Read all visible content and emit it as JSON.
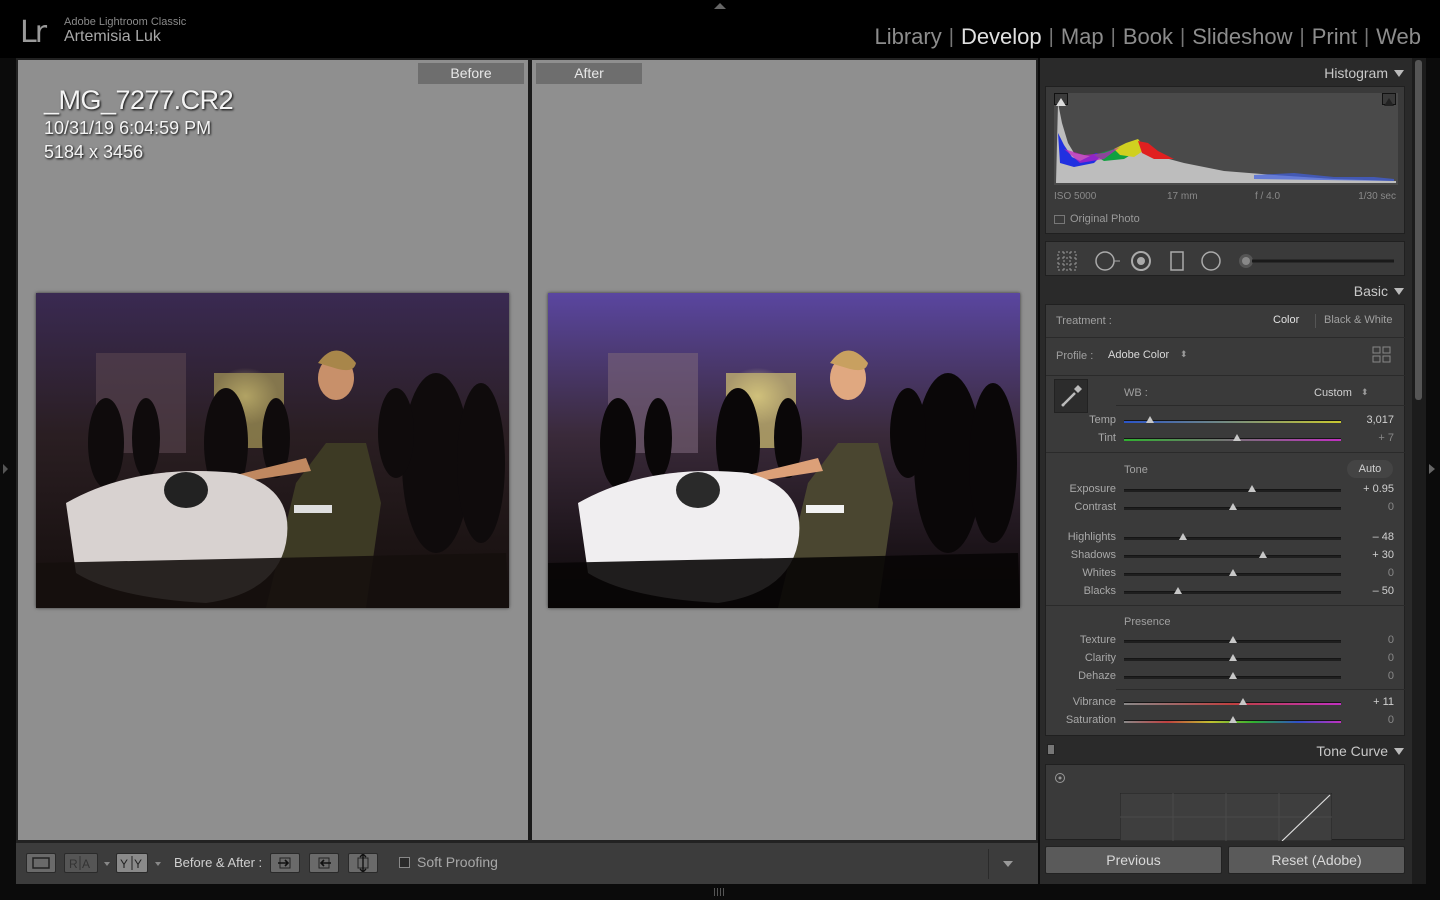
{
  "app": {
    "logo": "Lr",
    "product": "Adobe Lightroom Classic",
    "user": "Artemisia Luk"
  },
  "modules": [
    {
      "label": "Library",
      "active": false
    },
    {
      "label": "Develop",
      "active": true
    },
    {
      "label": "Map",
      "active": false
    },
    {
      "label": "Book",
      "active": false
    },
    {
      "label": "Slideshow",
      "active": false
    },
    {
      "label": "Print",
      "active": false
    },
    {
      "label": "Web",
      "active": false
    }
  ],
  "view": {
    "before_label": "Before",
    "after_label": "After",
    "info": {
      "filename": "_MG_7277.CR2",
      "datetime": "10/31/19 6:04:59 PM",
      "dimensions": "5184 x 3456"
    }
  },
  "toolbar": {
    "before_after_label": "Before & After :",
    "soft_proofing_label": "Soft Proofing",
    "soft_proofing_checked": false
  },
  "histogram": {
    "title": "Histogram",
    "iso": "ISO 5000",
    "focal": "17 mm",
    "aperture": "f / 4.0",
    "shutter": "1/30 sec",
    "original_photo_label": "Original Photo"
  },
  "basic": {
    "title": "Basic",
    "treatment_label": "Treatment :",
    "treatment_color": "Color",
    "treatment_bw": "Black & White",
    "profile_label": "Profile :",
    "profile_value": "Adobe Color",
    "wb_label": "WB :",
    "wb_value": "Custom",
    "tone_label": "Tone",
    "auto_label": "Auto",
    "presence_label": "Presence",
    "sliders": {
      "temp": {
        "label": "Temp",
        "value": "3,017",
        "pos": 0.12
      },
      "tint": {
        "label": "Tint",
        "value": "+ 7",
        "pos": 0.52
      },
      "exposure": {
        "label": "Exposure",
        "value": "+ 0.95",
        "pos": 0.59
      },
      "contrast": {
        "label": "Contrast",
        "value": "0",
        "pos": 0.5
      },
      "highlights": {
        "label": "Highlights",
        "value": "– 48",
        "pos": 0.27
      },
      "shadows": {
        "label": "Shadows",
        "value": "+ 30",
        "pos": 0.64
      },
      "whites": {
        "label": "Whites",
        "value": "0",
        "pos": 0.5
      },
      "blacks": {
        "label": "Blacks",
        "value": "– 50",
        "pos": 0.25
      },
      "texture": {
        "label": "Texture",
        "value": "0",
        "pos": 0.5
      },
      "clarity": {
        "label": "Clarity",
        "value": "0",
        "pos": 0.5
      },
      "dehaze": {
        "label": "Dehaze",
        "value": "0",
        "pos": 0.5
      },
      "vibrance": {
        "label": "Vibrance",
        "value": "+ 11",
        "pos": 0.55
      },
      "saturation": {
        "label": "Saturation",
        "value": "0",
        "pos": 0.5
      }
    }
  },
  "tone_curve": {
    "title": "Tone Curve"
  },
  "buttons": {
    "previous": "Previous",
    "reset": "Reset (Adobe)"
  }
}
